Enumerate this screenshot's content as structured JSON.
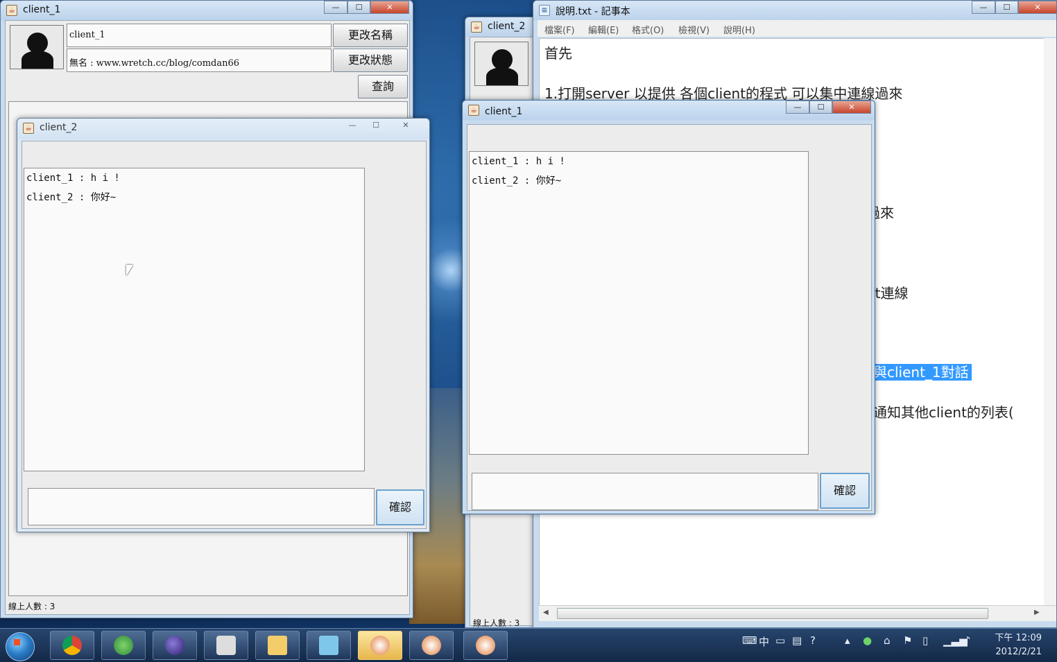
{
  "client1_main": {
    "title": "client_1",
    "name": "client_1",
    "status": "無名 : www.wretch.cc/blog/comdan66",
    "rename_button": "更改名稱",
    "status_button": "更改狀態",
    "query_button": "查詢",
    "online_count": "線上人數 : 3"
  },
  "client2_main": {
    "title": "client_2",
    "online_count": "線上人數 : 3"
  },
  "chat_client2": {
    "title": "client_2",
    "messages": [
      "client_1 : h i !",
      "client_2 : 你好~"
    ],
    "input_value": "",
    "confirm_button": "確認"
  },
  "chat_client1": {
    "title": "client_1",
    "messages": [
      "client_1 : h i !",
      "client_2 : 你好~"
    ],
    "input_value": "",
    "confirm_button": "確認"
  },
  "notepad": {
    "title": "說明.txt - 記事本",
    "menu": [
      "檔案(F)",
      "編輯(E)",
      "格式(O)",
      "檢視(V)",
      "說明(H)"
    ],
    "lines": [
      "首先",
      "1.打開server 以提供 各個client的程式 可以集中連線過來"
    ],
    "partial_lines": [
      "過來",
      "nt連線",
      "與client_1對話",
      "通知其他client的列表("
    ]
  },
  "taskbar": {
    "clock_time": "下午 12:09",
    "clock_date": "2012/2/21",
    "ime_label": "中"
  },
  "window_controls": {
    "minimize": "—",
    "maximize": "☐",
    "close": "✕"
  }
}
